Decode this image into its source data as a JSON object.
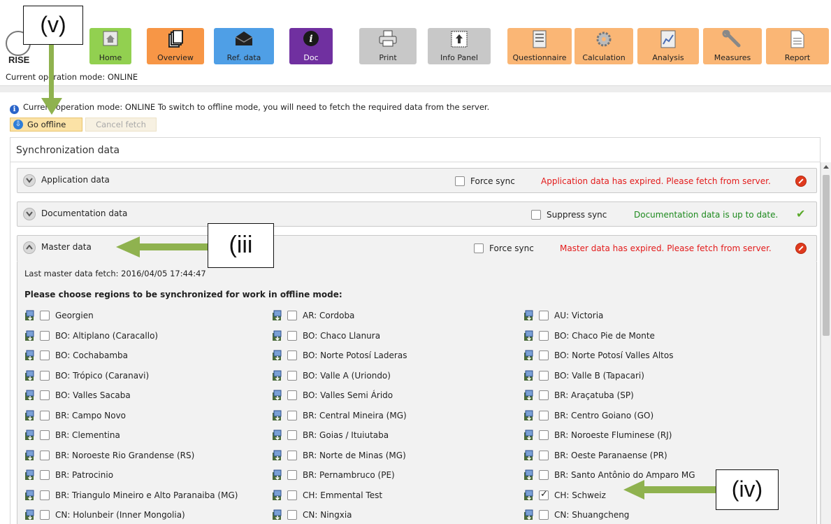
{
  "toolbar": {
    "brand": "RISE",
    "buttons": [
      {
        "label": "Home",
        "icon": "home-icon",
        "color": "#92d050"
      },
      {
        "label": "Overview",
        "icon": "documents-icon",
        "color": "#f79646"
      },
      {
        "label": "Ref. data",
        "icon": "envelope-icon",
        "color": "#4f9fe6"
      },
      {
        "label": "Doc",
        "icon": "info-icon",
        "color": "#7030a0"
      },
      {
        "label": "Print",
        "icon": "printer-icon",
        "color": "#c8c8c8"
      },
      {
        "label": "Info Panel",
        "icon": "info-panel-icon",
        "color": "#c8c8c8"
      },
      {
        "label": "Questionnaire",
        "icon": "questionnaire-icon",
        "color": "#fab675"
      },
      {
        "label": "Calculation",
        "icon": "gears-icon",
        "color": "#fab675"
      },
      {
        "label": "Analysis",
        "icon": "chart-icon",
        "color": "#fab675"
      },
      {
        "label": "Measures",
        "icon": "wrench-icon",
        "color": "#fab675"
      },
      {
        "label": "Report",
        "icon": "report-icon",
        "color": "#fab675"
      }
    ]
  },
  "status": {
    "opmode": "Current operation mode: ONLINE",
    "info": "Current operation mode: ONLINE   To switch to offline mode, you will need to fetch the required data from the server."
  },
  "actions": {
    "go_offline": "Go offline",
    "cancel_fetch": "Cancel fetch"
  },
  "sync": {
    "title": "Synchronization data",
    "application": {
      "title": "Application data",
      "option": "Force sync",
      "message": "Application data has expired. Please fetch from server.",
      "state": "error"
    },
    "documentation": {
      "title": "Documentation data",
      "option": "Suppress sync",
      "message": "Documentation data is up to date.",
      "state": "ok"
    },
    "master": {
      "title": "Master data",
      "option": "Force sync",
      "message": "Master data has expired. Please fetch from server.",
      "state": "error",
      "last_fetch": "Last master data fetch: 2016/04/05 17:44:47",
      "choose": "Please choose regions to be synchronized for work in offline mode:",
      "regions": [
        {
          "label": "Georgien",
          "checked": false
        },
        {
          "label": "AR: Cordoba",
          "checked": false
        },
        {
          "label": "AU: Victoria",
          "checked": false
        },
        {
          "label": "BO: Altiplano (Caracallo)",
          "checked": false
        },
        {
          "label": "BO: Chaco Llanura",
          "checked": false
        },
        {
          "label": "BO: Chaco Pie de Monte",
          "checked": false
        },
        {
          "label": "BO: Cochabamba",
          "checked": false
        },
        {
          "label": "BO: Norte Potosí Laderas",
          "checked": false
        },
        {
          "label": "BO: Norte Potosí Valles Altos",
          "checked": false
        },
        {
          "label": "BO: Trópico (Caranavi)",
          "checked": false
        },
        {
          "label": "BO: Valle A (Uriondo)",
          "checked": false
        },
        {
          "label": "BO: Valle B (Tapacari)",
          "checked": false
        },
        {
          "label": "BO: Valles Sacaba",
          "checked": false
        },
        {
          "label": "BO: Valles Semi Árido",
          "checked": false
        },
        {
          "label": "BR: Araçatuba (SP)",
          "checked": false
        },
        {
          "label": "BR: Campo Novo",
          "checked": false
        },
        {
          "label": "BR: Central Mineira (MG)",
          "checked": false
        },
        {
          "label": "BR: Centro Goiano (GO)",
          "checked": false
        },
        {
          "label": "BR: Clementina",
          "checked": false
        },
        {
          "label": "BR: Goias / Ituiutaba",
          "checked": false
        },
        {
          "label": "BR: Noroeste Fluminese (RJ)",
          "checked": false
        },
        {
          "label": "BR: Noroeste Rio Grandense (RS)",
          "checked": false
        },
        {
          "label": "BR: Norte de Minas (MG)",
          "checked": false
        },
        {
          "label": "BR: Oeste Paranaense (PR)",
          "checked": false
        },
        {
          "label": "BR: Patrocinio",
          "checked": false
        },
        {
          "label": "BR: Pernambruco (PE)",
          "checked": false
        },
        {
          "label": "BR: Santo Antônio do Amparo MG",
          "checked": false
        },
        {
          "label": "BR: Triangulo Mineiro e Alto Paranaiba (MG)",
          "checked": false
        },
        {
          "label": "CH: Emmental Test",
          "checked": false
        },
        {
          "label": "CH: Schweiz",
          "checked": true
        },
        {
          "label": "CN: Holunbeir (Inner Mongolia)",
          "checked": false
        },
        {
          "label": "CN: Ningxia",
          "checked": false
        },
        {
          "label": "CN: Shuangcheng",
          "checked": false
        }
      ]
    }
  },
  "annotations": {
    "v": "(v)",
    "iii": "(iii",
    "iv": "(iv)",
    "arrow_color": "#8fb24f"
  }
}
